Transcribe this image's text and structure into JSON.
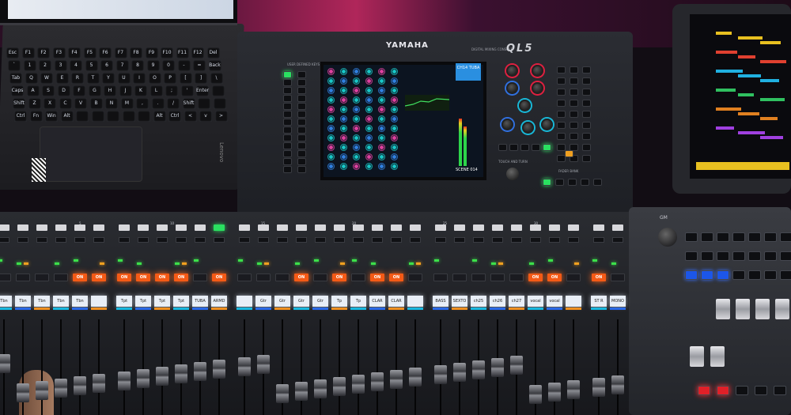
{
  "console": {
    "brand": "YAMAHA",
    "model": "QL5",
    "model_subtitle": "DIGITAL MIXING CONSOLE",
    "user_defined_label": "USER DEFINED KEYS",
    "touch_turn_label": "TOUCH AND TURN",
    "fader_bank_label": "FADER BANK"
  },
  "touchscreen": {
    "channel_label": "CH14 TUBA",
    "scene_readout": "SCENE 014",
    "colors": {
      "bg": "#0c1420",
      "knob_cyan": "#18c8c8",
      "knob_pink": "#e040a0",
      "knob_blue": "#3080e0"
    }
  },
  "laptop": {
    "brand": "Lenovo",
    "keyboard_rows": [
      [
        "Esc",
        "F1",
        "F2",
        "F3",
        "F4",
        "F5",
        "F6",
        "F7",
        "F8",
        "F9",
        "F10",
        "F11",
        "F12",
        "Del"
      ],
      [
        "`",
        "1",
        "2",
        "3",
        "4",
        "5",
        "6",
        "7",
        "8",
        "9",
        "0",
        "-",
        "=",
        "Back"
      ],
      [
        "Tab",
        "Q",
        "W",
        "E",
        "R",
        "T",
        "Y",
        "U",
        "I",
        "O",
        "P",
        "[",
        "]",
        "\\"
      ],
      [
        "Caps",
        "A",
        "S",
        "D",
        "F",
        "G",
        "H",
        "J",
        "K",
        "L",
        ";",
        "'",
        "Enter",
        ""
      ],
      [
        "Shift",
        "Z",
        "X",
        "C",
        "V",
        "B",
        "N",
        "M",
        ",",
        ".",
        "/",
        "Shift",
        "",
        ""
      ],
      [
        "Ctrl",
        "Fn",
        "Win",
        "Alt",
        "",
        "",
        "",
        "",
        "",
        "Alt",
        "Ctrl",
        "<",
        "v",
        ">"
      ]
    ]
  },
  "strips": {
    "names": [
      "Tbn",
      "Tbn",
      "Tbn",
      "Tbn",
      "Tbn",
      "",
      "Tpt",
      "Tpt",
      "Tpt",
      "Tpt",
      "TUBA",
      "ARMD",
      "",
      "Gtr",
      "Gtr",
      "Gtr",
      "Gtr",
      "Tp",
      "Tp",
      "CLAR",
      "CLAR",
      "",
      "BASS",
      "SEXTO",
      "ch25",
      "ch26",
      "ch27",
      "vocal",
      "vocal",
      "",
      "ST R",
      "MONO"
    ],
    "on_label": "ON",
    "on_states": [
      false,
      false,
      false,
      false,
      true,
      true,
      true,
      true,
      true,
      true,
      false,
      true,
      false,
      false,
      false,
      true,
      false,
      true,
      false,
      true,
      true,
      false,
      false,
      false,
      false,
      false,
      false,
      true,
      true,
      false,
      true,
      false
    ],
    "colors": {
      "on_lit": "#f45a16",
      "lcd": "#e8eef6",
      "bar_cyan": "#18b8e0",
      "bar_blue": "#2a6ae8",
      "bar_orange": "#f09020",
      "sel_lit": "#2ae060"
    },
    "group_labels": [
      "5",
      "10",
      "15",
      "20",
      "25",
      "30"
    ]
  },
  "controller": {
    "gm_label": "GM",
    "colors": {
      "blue": "#1c56e8",
      "red": "#e02028"
    }
  },
  "tablet": {
    "row_colors": [
      "#e8c020",
      "#e04030",
      "#20b0e0",
      "#30c060",
      "#e08020",
      "#a040e0"
    ]
  }
}
